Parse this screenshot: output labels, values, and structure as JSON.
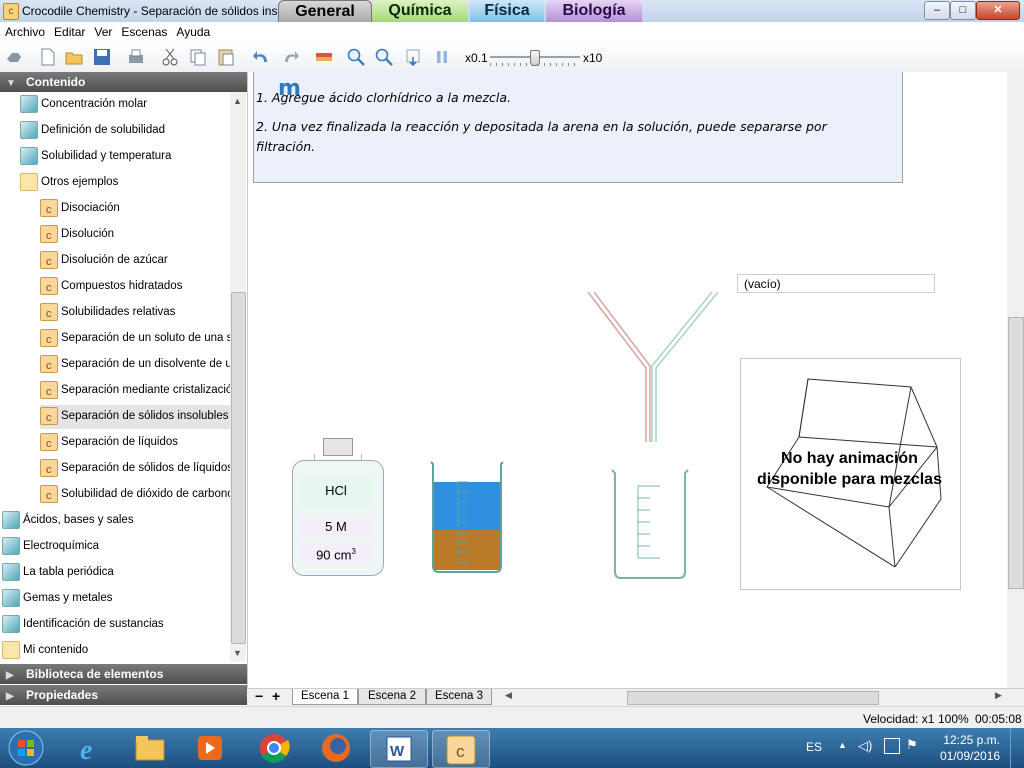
{
  "window": {
    "title": "Crocodile Chemistry - Separación de sólidos insolubles",
    "app_icon": "c"
  },
  "category_tabs": [
    {
      "label": "General",
      "color": "#b0b0b0"
    },
    {
      "label": "Química",
      "color": "#a6d77a"
    },
    {
      "label": "Física",
      "color": "#7fc2e7"
    },
    {
      "label": "Biología",
      "color": "#b48fd6"
    }
  ],
  "window_controls": {
    "min": "–",
    "max": "□",
    "close": "✕"
  },
  "menu": [
    "Archivo",
    "Editar",
    "Ver",
    "Escenas",
    "Ayuda"
  ],
  "toolbar": {
    "speed_min": "x0.1",
    "speed_max": "x10",
    "icons": [
      "hand-tool-icon",
      "new-file-icon",
      "open-folder-icon",
      "save-icon",
      "print-icon",
      "cut-icon",
      "copy-icon",
      "paste-icon",
      "undo-icon",
      "redo-icon",
      "measure-icon",
      "zoom-in-icon",
      "zoom-out-icon",
      "step-icon",
      "pause-icon"
    ]
  },
  "sidebar": {
    "content_header": "Contenido",
    "library_header": "Biblioteca de elementos",
    "properties_header": "Propiedades",
    "items": [
      {
        "label": "Concentración molar",
        "indent": 1,
        "icon": "img"
      },
      {
        "label": "Definición de solubilidad",
        "indent": 1,
        "icon": "img"
      },
      {
        "label": "Solubilidad y temperatura",
        "indent": 1,
        "icon": "img"
      },
      {
        "label": "Otros ejemplos",
        "indent": 1,
        "icon": "folder"
      },
      {
        "label": "Disociación",
        "indent": 2,
        "icon": "c"
      },
      {
        "label": "Disolución",
        "indent": 2,
        "icon": "c"
      },
      {
        "label": "Disolución de azúcar",
        "indent": 2,
        "icon": "c"
      },
      {
        "label": "Compuestos hidratados",
        "indent": 2,
        "icon": "c"
      },
      {
        "label": "Solubilidades relativas",
        "indent": 2,
        "icon": "c"
      },
      {
        "label": "Separación de un soluto de una sc",
        "indent": 2,
        "icon": "c"
      },
      {
        "label": "Separación de un disolvente de ur",
        "indent": 2,
        "icon": "c"
      },
      {
        "label": "Separación mediante cristalizació",
        "indent": 2,
        "icon": "c"
      },
      {
        "label": "Separación de sólidos insolubles",
        "indent": 2,
        "icon": "c",
        "selected": true
      },
      {
        "label": "Separación de líquidos",
        "indent": 2,
        "icon": "c"
      },
      {
        "label": "Separación de sólidos de líquidos",
        "indent": 2,
        "icon": "c"
      },
      {
        "label": "Solubilidad de dióxido de carbono",
        "indent": 2,
        "icon": "c"
      },
      {
        "label": "Ácidos, bases y sales",
        "indent": 0,
        "icon": "img"
      },
      {
        "label": "Electroquímica",
        "indent": 0,
        "icon": "img"
      },
      {
        "label": "La tabla periódica",
        "indent": 0,
        "icon": "img"
      },
      {
        "label": "Gemas y metales",
        "indent": 0,
        "icon": "img"
      },
      {
        "label": "Identificación de sustancias",
        "indent": 0,
        "icon": "img"
      },
      {
        "label": "Mi contenido",
        "indent": 0,
        "icon": "folder"
      }
    ]
  },
  "instructions": {
    "logo": "m",
    "line1": "1. Agregue ácido clorhídrico a la mezcla.",
    "line2a": "2. Una vez finalizada la reacción y depositada la arena en la solución, puede separarse por",
    "line2b": "filtración."
  },
  "bottle": {
    "label": "HCl",
    "concentration": "5 M",
    "volume": "90 cm",
    "volume_sup": "3"
  },
  "meter": {
    "value": "(vacío)"
  },
  "animation": {
    "line1": "No hay animación",
    "line2": "disponible para mezclas"
  },
  "scenes": {
    "remove": "−",
    "add": "+",
    "tabs": [
      "Escena 1",
      "Escena 2",
      "Escena 3"
    ]
  },
  "status": {
    "speed": "Velocidad: x1",
    "zoom": "100%",
    "time": "00:05:08"
  },
  "taskbar": {
    "language": "ES",
    "time": "12:25 p.m.",
    "date": "01/09/2016"
  }
}
